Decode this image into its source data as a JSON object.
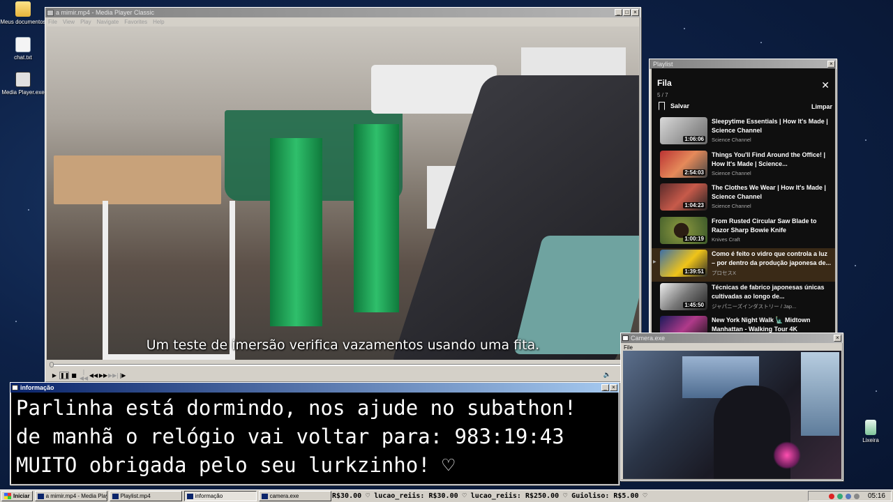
{
  "desktop": {
    "icons": [
      {
        "label": "Meus documentos",
        "icon": "folder-icon"
      },
      {
        "label": "chat.txt",
        "icon": "text-file-icon"
      },
      {
        "label": "Media Player.exe",
        "icon": "media-player-icon"
      },
      {
        "label": "Lixeira",
        "icon": "recycle-bin-icon"
      }
    ]
  },
  "player": {
    "title": "a mimir.mp4 - Media Player Classic",
    "menu": [
      "File",
      "View",
      "Play",
      "Navigate",
      "Favorites",
      "Help"
    ],
    "subtitle": "Um teste de imersão verifica vazamentos usando uma fita.",
    "progress": 0.0
  },
  "playlist": {
    "window_title": "Playlist",
    "header": "Fila",
    "count": "5 / 7",
    "save_label": "Salvar",
    "clear_label": "Limpar",
    "items": [
      {
        "title": "Sleepytime Essentials | How It's Made | Science Channel",
        "channel": "Science Channel",
        "duration": "1:06:06",
        "active": false
      },
      {
        "title": "Things You'll Find Around the Office! | How It's Made | Science...",
        "channel": "Science Channel",
        "duration": "2:54:03",
        "active": false
      },
      {
        "title": "The Clothes We Wear | How It's Made | Science Channel",
        "channel": "Science Channel",
        "duration": "1:04:23",
        "active": false
      },
      {
        "title": "From Rusted Circular Saw Blade to Razor Sharp Bowie Knife",
        "channel": "Knives Craft",
        "duration": "1:00:19",
        "active": false
      },
      {
        "title": "Como é feito o vidro que controla a luz – por dentro da produção japonesa de...",
        "channel": "プロセスX",
        "duration": "1:39:51",
        "active": true
      },
      {
        "title": "Técnicas de fabrico japonesas únicas cultivadas ao longo de...",
        "channel": "ジャパニーズインダストリー / Jap...",
        "duration": "1:45:50",
        "active": false
      },
      {
        "title": "New York Night Walk 🗽 Midtown Manhattan - Walking Tour 4K",
        "channel": "",
        "duration": "",
        "active": false
      }
    ]
  },
  "info": {
    "window_title": "informação",
    "lines": [
      "Parlinha está dormindo, nos ajude no subathon!",
      "de manhã o relógio vai voltar para:  983:19:43",
      "MUITO obrigada pelo seu lurkzinho! ♡"
    ]
  },
  "camera": {
    "window_title": "Camera.exe",
    "menu": [
      "File"
    ]
  },
  "taskbar": {
    "start_label": "Iniciar",
    "buttons": [
      {
        "label": "a mimir.mp4 - Media Playe...",
        "pressed": false
      },
      {
        "label": "Playlist.mp4",
        "pressed": false
      },
      {
        "label": "informação",
        "pressed": true
      },
      {
        "label": "camera.exe",
        "pressed": false
      }
    ],
    "ticker": "R$30.00 ♡  lucao_reiis: R$30.00 ♡  lucao_reiis: R$250.00 ♡  Guioliso: R$5.00 ♡",
    "clock": "05:16"
  }
}
